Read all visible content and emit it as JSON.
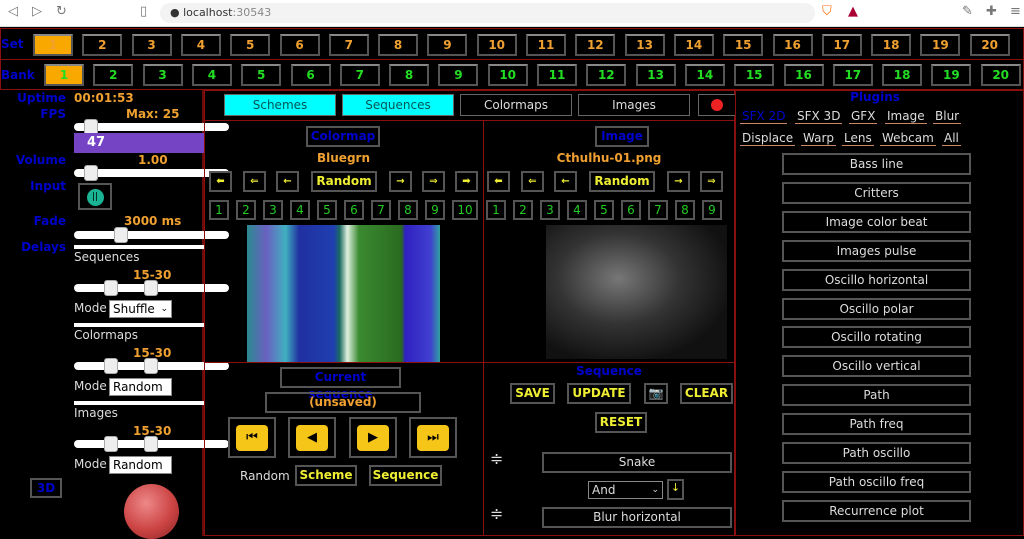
{
  "browser": {
    "url_host": "localhost",
    "url_port": ":30543"
  },
  "set": {
    "label": "Set",
    "items": [
      "1",
      "2",
      "3",
      "4",
      "5",
      "6",
      "7",
      "8",
      "9",
      "10",
      "11",
      "12",
      "13",
      "14",
      "15",
      "16",
      "17",
      "18",
      "19",
      "20"
    ],
    "selected": "1"
  },
  "bank": {
    "label": "Bank",
    "items": [
      "1",
      "2",
      "3",
      "4",
      "5",
      "6",
      "7",
      "8",
      "9",
      "10",
      "11",
      "12",
      "13",
      "14",
      "15",
      "16",
      "17",
      "18",
      "19",
      "20"
    ],
    "selected": "1"
  },
  "left": {
    "uptime_label": "Uptime",
    "uptime": "00:01:53",
    "fps_label": "FPS",
    "fps_max": "Max: 25",
    "fps_value": "47",
    "volume_label": "Volume",
    "volume": "1.00",
    "input_label": "Input",
    "fade_label": "Fade",
    "fade": "3000 ms",
    "delays_label": "Delays",
    "sequences_label": "Sequences",
    "seq_range": "15-30",
    "mode_label": "Mode",
    "seq_mode": "Shuffle",
    "colormaps_label": "Colormaps",
    "cm_range": "15-30",
    "cm_mode": "Random",
    "images_label": "Images",
    "img_range": "15-30",
    "img_mode": "Random",
    "btn_3d": "3D"
  },
  "tabs": {
    "schemes": "Schemes",
    "sequences": "Sequences",
    "colormaps": "Colormaps",
    "images": "Images"
  },
  "colormap": {
    "title": "Colormap",
    "name": "Bluegrn",
    "random": "Random",
    "numbers": [
      "1",
      "2",
      "3",
      "4",
      "5",
      "6",
      "7",
      "8",
      "9",
      "10"
    ]
  },
  "image": {
    "title": "Image",
    "name": "Cthulhu-01.png",
    "random": "Random",
    "numbers": [
      "1",
      "2",
      "3",
      "4",
      "5",
      "6",
      "7",
      "8",
      "9"
    ]
  },
  "arrows": {
    "first": "⬅",
    "prev2": "⇐",
    "prev": "←",
    "next": "→",
    "next2": "⇒",
    "last": "➡"
  },
  "current_sequence": {
    "title": "Current sequence",
    "name": "(unsaved)",
    "random_label": "Random",
    "scheme": "Scheme",
    "sequence": "Sequence"
  },
  "sequence": {
    "title": "Sequence",
    "save": "SAVE",
    "update": "UPDATE",
    "clear": "CLEAR",
    "reset": "RESET",
    "plugin1": "Snake",
    "operator": "And",
    "down": "↓",
    "plugin2": "Blur horizontal"
  },
  "plugins": {
    "title": "Plugins",
    "tabs": [
      "SFX 2D",
      "SFX 3D",
      "GFX",
      "Image",
      "Blur",
      "Displace",
      "Warp",
      "Lens",
      "Webcam",
      "All"
    ],
    "active_tab": "SFX 2D",
    "items": [
      "Bass line",
      "Critters",
      "Image color beat",
      "Images pulse",
      "Oscillo horizontal",
      "Oscillo polar",
      "Oscillo rotating",
      "Oscillo vertical",
      "Path",
      "Path freq",
      "Path oscillo",
      "Path oscillo freq",
      "Recurrence plot"
    ]
  },
  "colors": {
    "accent": "#f9a800",
    "label_blue": "#0000cc",
    "tab_active": "#00ffff",
    "frame": "#8a1010"
  }
}
